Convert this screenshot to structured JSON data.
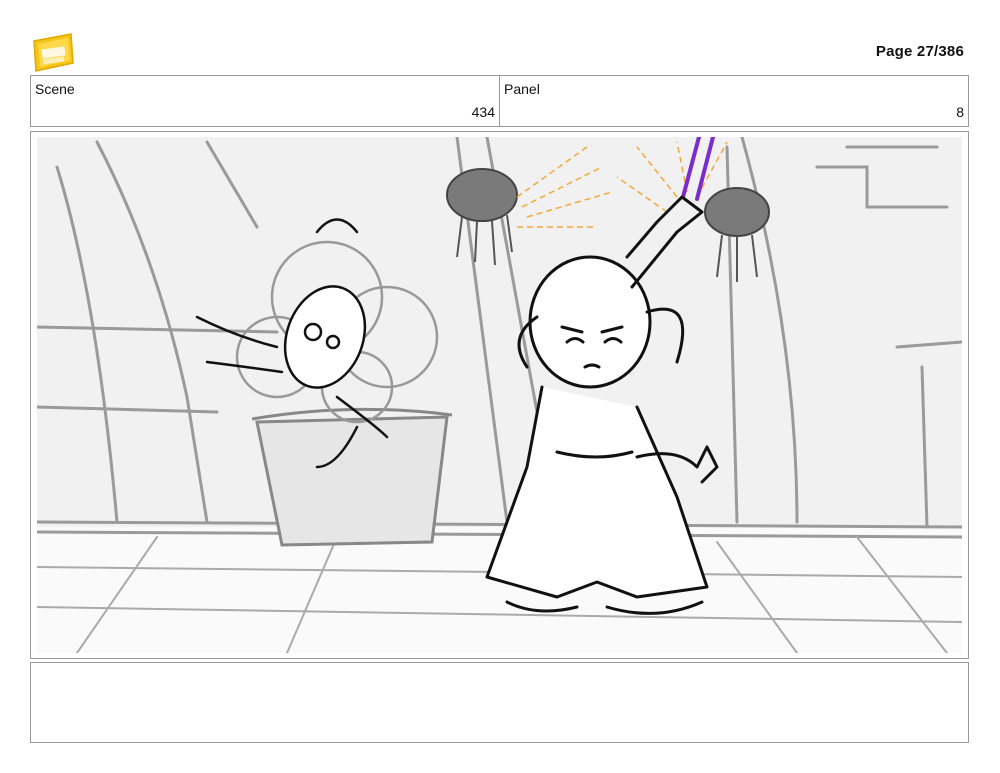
{
  "header": {
    "logo_icon": "young-jedi-adventures-logo",
    "page_label": "Page",
    "page_number": "27/386"
  },
  "info": {
    "scene_label": "Scene",
    "scene_value": "434",
    "panel_label": "Panel",
    "panel_value": "8"
  },
  "panel_image": {
    "description_icon": "storyboard-sketch",
    "accent_colors": {
      "lightsaber": "#7a2ccf",
      "glow": "#f2a93b",
      "ink": "#111111",
      "tone": "#9a9a9a"
    }
  },
  "notes": {
    "text": ""
  }
}
